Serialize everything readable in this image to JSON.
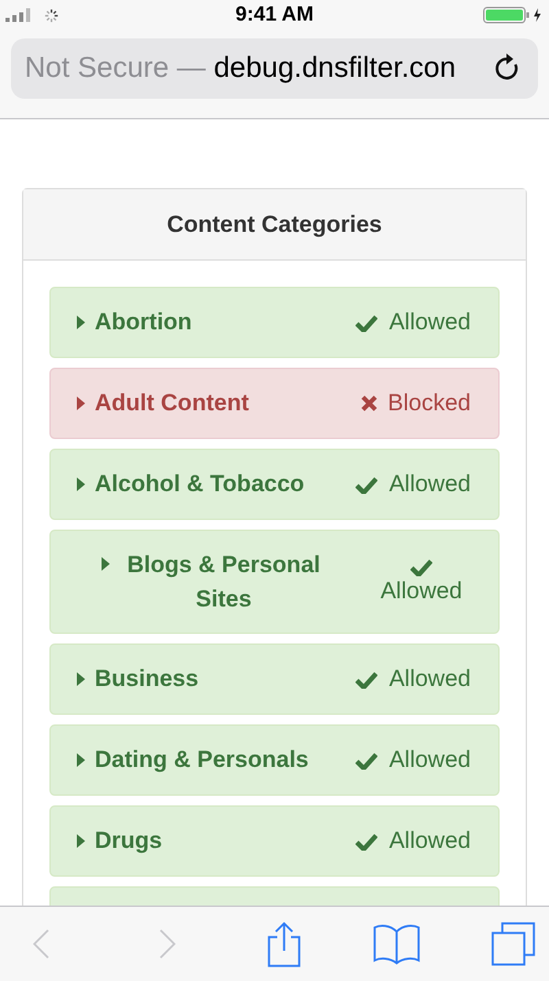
{
  "status_bar": {
    "time": "9:41 AM"
  },
  "address_bar": {
    "security": "Not Secure —",
    "url": "debug.dnsfilter.con"
  },
  "panel": {
    "title": "Content Categories",
    "rows": [
      {
        "name": "Abortion",
        "blocked": false,
        "label": "Allowed",
        "kind": "inline"
      },
      {
        "name": "Adult Content",
        "blocked": true,
        "label": "Blocked",
        "kind": "inline"
      },
      {
        "name": "Alcohol & Tobacco",
        "blocked": false,
        "label": "Allowed",
        "kind": "inline"
      },
      {
        "name": "Blogs & Personal Sites",
        "blocked": false,
        "label": "Allowed",
        "kind": "stacked"
      },
      {
        "name": "Business",
        "blocked": false,
        "label": "Allowed",
        "kind": "inline"
      },
      {
        "name": "Dating & Personals",
        "blocked": false,
        "label": "Allowed",
        "kind": "inline"
      },
      {
        "name": "Drugs",
        "blocked": false,
        "label": "Allowed",
        "kind": "inline"
      },
      {
        "blocked": false,
        "kind": "partial"
      }
    ]
  },
  "toolbar": {
    "back": {
      "disabled": true
    },
    "forward": {
      "disabled": true
    }
  }
}
